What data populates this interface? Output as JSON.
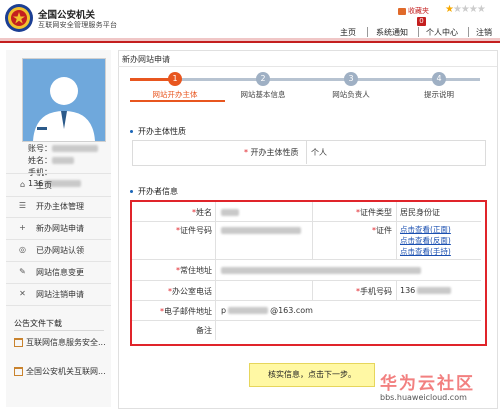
{
  "header": {
    "logo_title": "全国公安机关",
    "logo_subtitle": "互联网安全管理服务平台",
    "favorites": "收藏夹",
    "notify_count": "0",
    "stars_filled": 1,
    "stars_total": 5,
    "nav": [
      "主页",
      "系统通知",
      "个人中心",
      "注销"
    ]
  },
  "user": {
    "account_label": "账号：",
    "name_label": "姓名：",
    "phone_label": "手机：",
    "phone_prefix": "136"
  },
  "sidebar": {
    "items": [
      {
        "icon": "home-icon",
        "glyph": "⌂",
        "label": "主页"
      },
      {
        "icon": "list-icon",
        "glyph": "☰",
        "label": "开办主体管理"
      },
      {
        "icon": "plus-icon",
        "glyph": "+",
        "label": "新办网站申请"
      },
      {
        "icon": "globe-icon",
        "glyph": "◎",
        "label": "已办网站认领"
      },
      {
        "icon": "edit-icon",
        "glyph": "✎",
        "label": "网站信息变更"
      },
      {
        "icon": "close-icon",
        "glyph": "✕",
        "label": "网站注销申请"
      }
    ],
    "docs_title": "公告文件下载",
    "docs": [
      "互联网信息服务安全...",
      "全国公安机关互联网..."
    ]
  },
  "main": {
    "title": "新办网站申请",
    "steps": [
      {
        "num": "1",
        "label": "网站开办主体",
        "active": true
      },
      {
        "num": "2",
        "label": "网站基本信息",
        "active": false
      },
      {
        "num": "3",
        "label": "网站负责人",
        "active": false
      },
      {
        "num": "4",
        "label": "提示说明",
        "active": false
      }
    ],
    "section1": "开办主体性质",
    "nature_label": "开办主体性质",
    "nature_value": "个人",
    "section2": "开办者信息",
    "fields": {
      "name": "姓名",
      "cert_type": "证件类型",
      "cert_type_value": "居民身份证",
      "cert_no": "证件号码",
      "cert": "证件",
      "cert_links": [
        "点击查看(正面)",
        "点击查看(反面)",
        "点击查看(手持)"
      ],
      "address": "常住地址",
      "office_phone": "办公室电话",
      "mobile": "手机号码",
      "mobile_prefix": "136",
      "email": "电子邮件地址",
      "email_prefix": "p",
      "email_domain": "@163.com",
      "remark": "备注"
    },
    "required_mark": "*"
  },
  "tip": "核实信息，点击下一步。",
  "watermark": {
    "cn": "华为云社区",
    "url": "bbs.huaweicloud.com"
  },
  "colors": {
    "accent": "#e8561f",
    "inactive_step": "#8aa0b8",
    "danger": "#e0242a",
    "link": "#1a4fb0"
  }
}
